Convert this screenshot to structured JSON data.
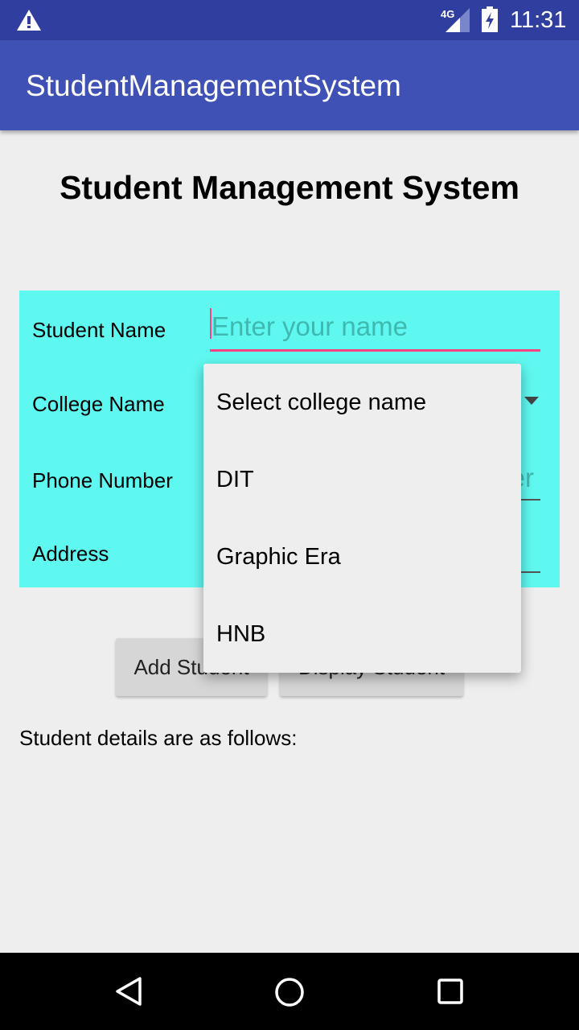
{
  "status_bar": {
    "time": "11:31",
    "network": "4G",
    "icons": [
      "warning-icon",
      "signal-icon",
      "battery-charging-icon"
    ]
  },
  "app_bar": {
    "title": "StudentManagementSystem"
  },
  "page": {
    "heading": "Student Management System"
  },
  "form": {
    "student_name": {
      "label": "Student Name",
      "placeholder": "Enter your name"
    },
    "college_name": {
      "label": "College Name"
    },
    "phone_number": {
      "label": "Phone Number",
      "placeholder_visible": "er"
    },
    "address": {
      "label": "Address"
    }
  },
  "buttons": {
    "add": "Add Student",
    "display": "Display Student"
  },
  "details_text": "Student details are as follows:",
  "dropdown": {
    "options": [
      "Select college name",
      "DIT",
      "Graphic Era",
      "HNB"
    ]
  },
  "colors": {
    "status_bar": "#303f9f",
    "app_bar": "#3f51b5",
    "form_bg": "#5ff8f0",
    "accent": "#ff4081"
  }
}
